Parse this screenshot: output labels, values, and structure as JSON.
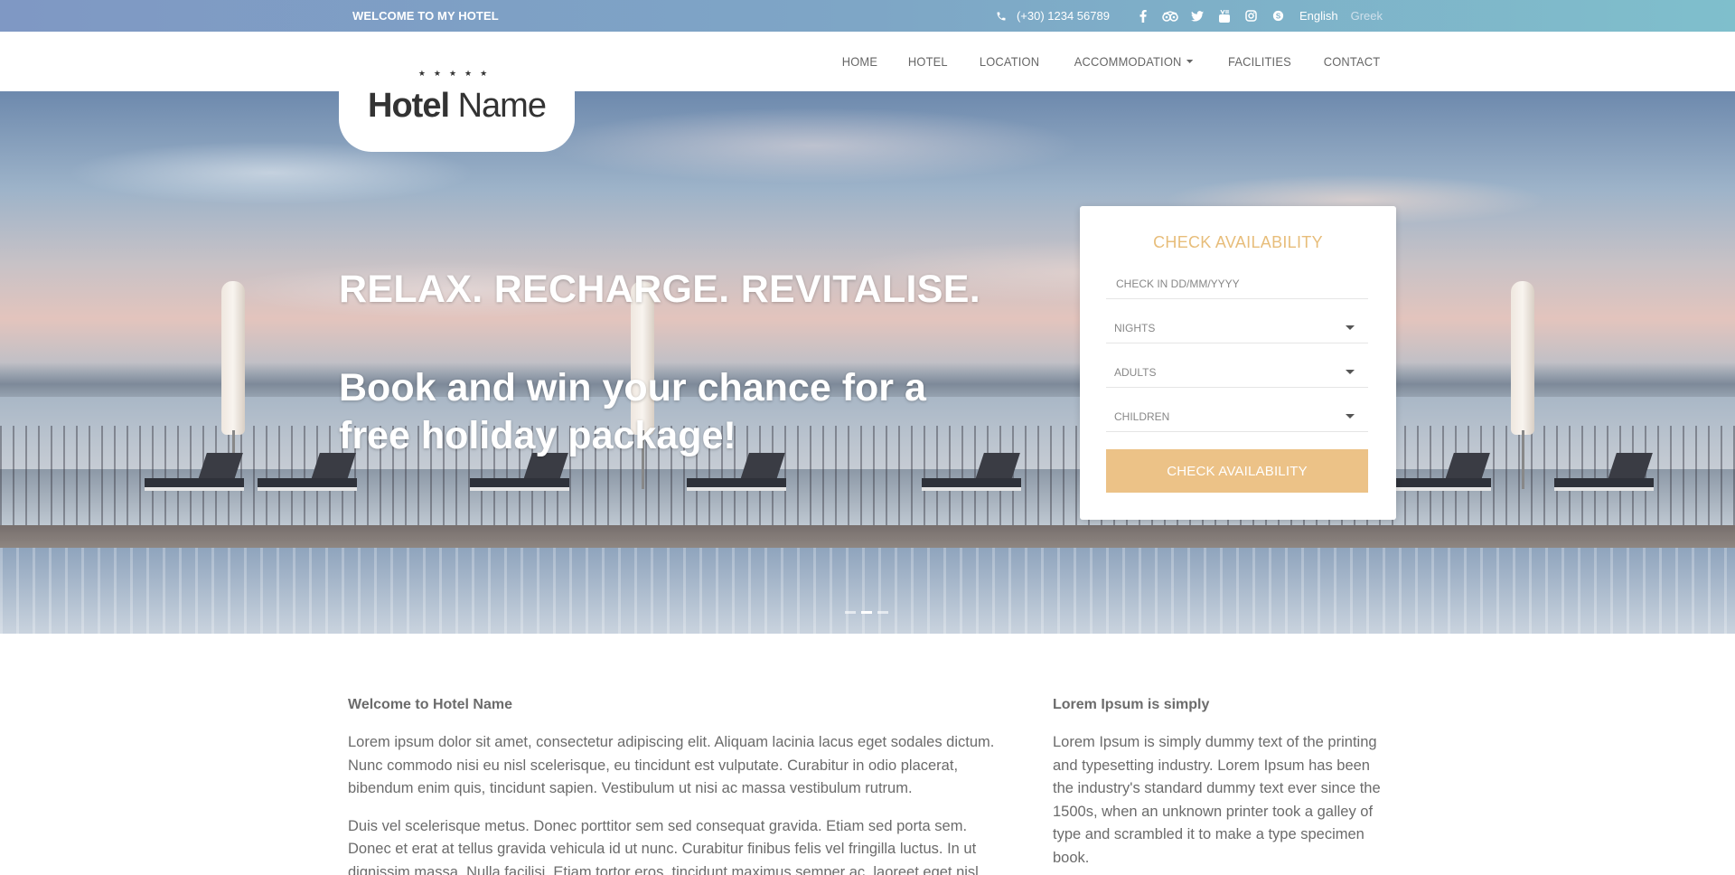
{
  "topbar": {
    "welcome": "WELCOME TO MY HOTEL",
    "phone": "(+30) 1234 56789",
    "social": [
      "facebook-icon",
      "tripadvisor-icon",
      "twitter-icon",
      "youtube-icon",
      "instagram-icon",
      "skype-icon"
    ],
    "languages": [
      {
        "label": "English",
        "active": true
      },
      {
        "label": "Greek",
        "active": false
      }
    ]
  },
  "logo": {
    "name_bold": "Hotel",
    "name_regular": " Name",
    "stars": "★★★★★"
  },
  "nav": {
    "items": [
      "HOME",
      "HOTEL",
      "LOCATION",
      "ACCOMMODATION",
      "FACILITIES",
      "CONTACT"
    ]
  },
  "hero": {
    "headline": "RELAX. RECHARGE. REVITALISE.",
    "subheadline": "Book and win your chance for a free holiday package!"
  },
  "booking": {
    "title": "CHECK AVAILABILITY",
    "checkin_placeholder": "CHECK IN DD/MM/YYYY",
    "nights": "NIGHTS",
    "adults": "ADULTS",
    "children": "CHILDREN",
    "button": "CHECK AVAILABILITY"
  },
  "content": {
    "left": {
      "heading": "Welcome to Hotel Name",
      "p1": "Lorem ipsum dolor sit amet, consectetur adipiscing elit. Aliquam lacinia lacus eget sodales dictum. Nunc commodo nisi eu nisl scelerisque, eu tincidunt est vulputate. Curabitur in odio placerat, bibendum enim quis, tincidunt sapien. Vestibulum ut nisi ac massa vestibulum rutrum.",
      "p2": "Duis vel scelerisque metus. Donec porttitor sem sed consequat gravida. Etiam sed porta sem. Donec et erat at tellus gravida vehicula id ut nunc. Curabitur finibus felis vel fringilla luctus. In ut dignissim massa. Nulla facilisi. Etiam tortor eros, tincidunt maximus semper ac, laoreet eget nisl."
    },
    "right": {
      "heading": "Lorem Ipsum is simply",
      "p1": "Lorem Ipsum is simply dummy text of the printing and typesetting industry. Lorem Ipsum has been the industry's standard dummy text ever since the 1500s, when an unknown printer took a galley of type and scrambled it to make a type specimen book."
    }
  },
  "colors": {
    "accent": "#ecc287",
    "accent_text": "#e7bd7a",
    "topbar_start": "#7f98c4",
    "topbar_end": "#7fbfcc"
  }
}
